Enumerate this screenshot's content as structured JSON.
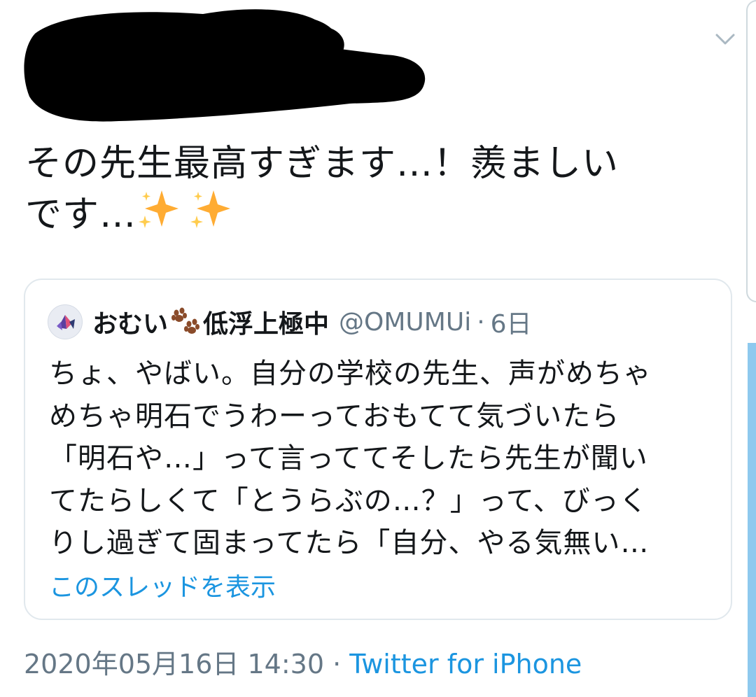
{
  "tweet": {
    "text_line1": "その先生最高すぎます…！羨ましい",
    "text_line2": "です…",
    "emoji": "sparkles"
  },
  "quoted": {
    "display_name_part1": "おむい",
    "display_name_part2": "低浮上極中",
    "handle": "@OMUMUi",
    "separator": "·",
    "relative_time": "6日",
    "body": [
      "ちょ、やばい。自分の学校の先生、声がめちゃ",
      "めちゃ明石でうわーっておもてて気づいたら",
      "「明石や…」って言っててそしたら先生が聞い",
      "てたらしくて「とうらぶの…？」って、びっく",
      "りし過ぎて固まってたら「自分、やる気無い…"
    ],
    "show_thread": "このスレッドを表示"
  },
  "meta": {
    "timestamp": "2020年05月16日 14:30",
    "separator": " · ",
    "source": "Twitter for iPhone"
  },
  "colors": {
    "text": "#14171a",
    "secondary": "#657786",
    "link": "#1b95e0",
    "border": "#e1e8ed",
    "sparkle": "#ffac33"
  },
  "icons": [
    "redaction-scribble",
    "chevron-down-icon",
    "sparkles-emoji",
    "paw-prints-emoji",
    "avatar"
  ]
}
